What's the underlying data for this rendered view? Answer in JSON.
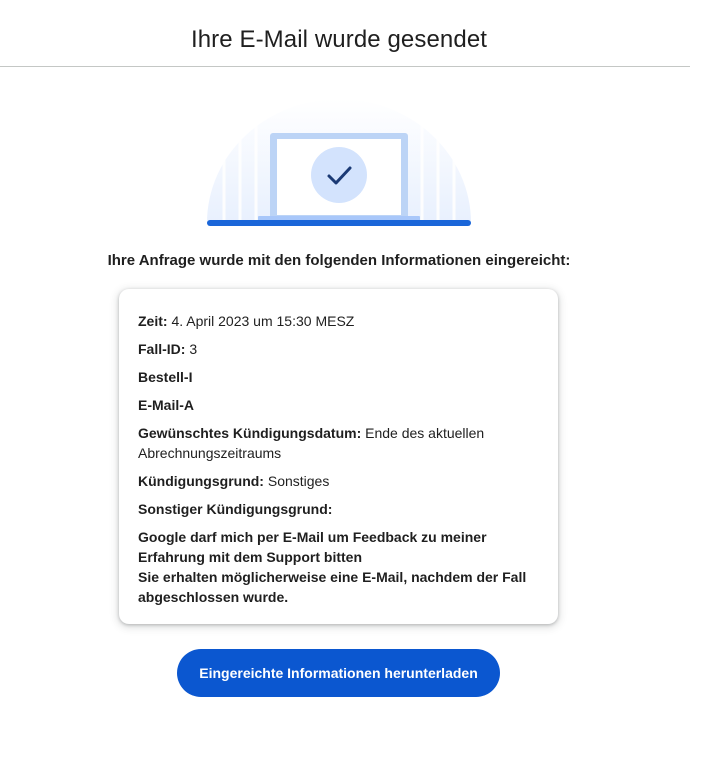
{
  "header": {
    "title": "Ihre E-Mail wurde gesendet"
  },
  "illustration": {
    "icon": "checkmark-icon",
    "colors": {
      "accent": "#1a66d9",
      "laptop_frame": "#bcd4f6",
      "check_circle": "#d3e3fd",
      "check": "#1b3a75"
    }
  },
  "main": {
    "subheading": "Ihre Anfrage wurde mit den folgenden Informationen eingereicht:",
    "fields": {
      "zeit_label": "Zeit:",
      "zeit_value": "4. April 2023 um 15:30 MESZ",
      "fall_id_label": "Fall-ID:",
      "fall_id_value": "3",
      "bestell_label": "Bestell-I",
      "email_label": "E-Mail-A",
      "kuendigungsdatum_label": "Gewünschtes Kündigungsdatum:",
      "kuendigungsdatum_value": "Ende des aktuellen Abrechnungszeitraums",
      "kuendigungsgrund_label": "Kündigungsgrund:",
      "kuendigungsgrund_value": "Sonstiges",
      "sonstiger_grund_label": "Sonstiger Kündigungsgrund:"
    },
    "consent_line1": "Google darf mich per E-Mail um Feedback zu meiner Erfahrung mit dem Support bitten",
    "consent_line2": "Sie erhalten möglicherweise eine E-Mail, nachdem der Fall abgeschlossen wurde."
  },
  "actions": {
    "download_label": "Eingereichte Informationen herunterladen",
    "button_color": "#0b57d0"
  }
}
